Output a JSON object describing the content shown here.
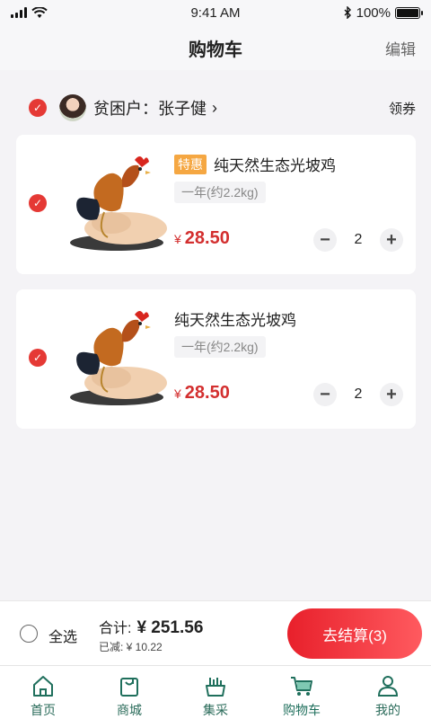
{
  "status_bar": {
    "time": "9:41 AM",
    "battery_text": "100%",
    "battery_level": 1.0
  },
  "nav": {
    "title": "购物车",
    "edit_label": "编辑"
  },
  "farmer": {
    "label": "贫困户：张子健",
    "coupon_label": "领券",
    "selected": true
  },
  "cart_items": [
    {
      "tag": "特惠",
      "title": "纯天然生态光坡鸡",
      "spec": "一年(约2.2kg)",
      "currency": "¥",
      "price": "28.50",
      "quantity": "2",
      "selected": true
    },
    {
      "tag": "",
      "title": "纯天然生态光坡鸡",
      "spec": "一年(约2.2kg)",
      "currency": "¥",
      "price": "28.50",
      "quantity": "2",
      "selected": true
    }
  ],
  "checkout": {
    "select_all_label": "全选",
    "total_label": "合计:",
    "total_amount": "¥ 251.56",
    "saved_text": "已减: ¥ 10.22",
    "button_label": "去结算(3)"
  },
  "tabs": [
    {
      "label": "首页",
      "icon": "home-icon"
    },
    {
      "label": "商城",
      "icon": "shopping-bag-icon"
    },
    {
      "label": "集采",
      "icon": "basket-icon"
    },
    {
      "label": "购物车",
      "icon": "cart-icon",
      "active": true
    },
    {
      "label": "我的",
      "icon": "profile-icon"
    }
  ],
  "colors": {
    "accent_red": "#e53935",
    "price_red": "#d32f2f",
    "tab_green": "#1f6f5c",
    "tag_orange": "#f5a742"
  }
}
